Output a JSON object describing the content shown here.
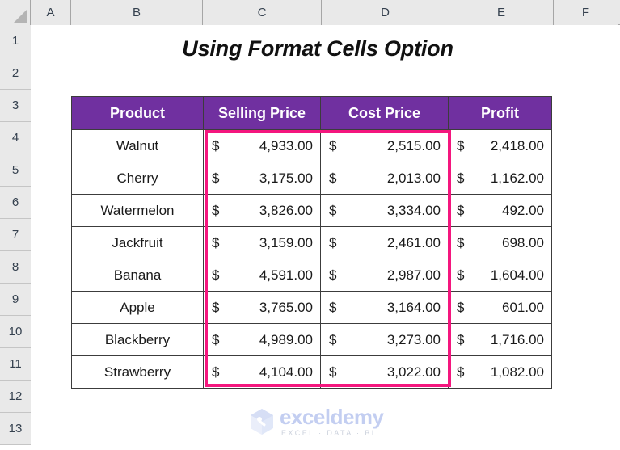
{
  "sheet": {
    "title": "Using Format Cells Option",
    "columns": [
      "A",
      "B",
      "C",
      "D",
      "E",
      "F"
    ],
    "rows": [
      "1",
      "2",
      "3",
      "4",
      "5",
      "6",
      "7",
      "8",
      "9",
      "10",
      "11",
      "12",
      "13"
    ],
    "header_fill": "#7030A0",
    "selection_color": "#F4167E"
  },
  "table": {
    "headers": [
      "Product",
      "Selling Price",
      "Cost Price",
      "Profit"
    ],
    "currency_symbol": "$",
    "rows": [
      {
        "product": "Walnut",
        "selling": "4,933.00",
        "cost": "2,515.00",
        "profit": "2,418.00"
      },
      {
        "product": "Cherry",
        "selling": "3,175.00",
        "cost": "2,013.00",
        "profit": "1,162.00"
      },
      {
        "product": "Watermelon",
        "selling": "3,826.00",
        "cost": "3,334.00",
        "profit": "492.00"
      },
      {
        "product": "Jackfruit",
        "selling": "3,159.00",
        "cost": "2,461.00",
        "profit": "698.00"
      },
      {
        "product": "Banana",
        "selling": "4,591.00",
        "cost": "2,987.00",
        "profit": "1,604.00"
      },
      {
        "product": "Apple",
        "selling": "3,765.00",
        "cost": "3,164.00",
        "profit": "601.00"
      },
      {
        "product": "Blackberry",
        "selling": "4,989.00",
        "cost": "3,273.00",
        "profit": "1,716.00"
      },
      {
        "product": "Strawberry",
        "selling": "4,104.00",
        "cost": "3,022.00",
        "profit": "1,082.00"
      }
    ]
  },
  "watermark": {
    "name": "exceldemy",
    "tagline": "EXCEL · DATA · BI"
  }
}
